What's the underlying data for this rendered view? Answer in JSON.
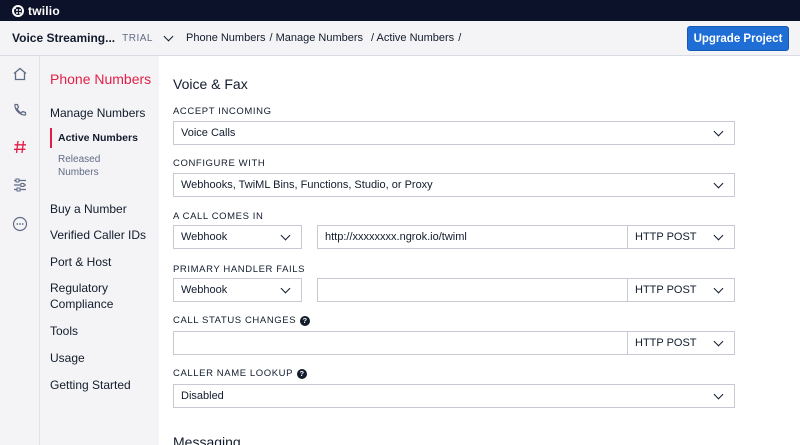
{
  "topbar": {
    "logo_text": "twilio"
  },
  "header": {
    "project_name": "Voice Streaming...",
    "plan_badge": "TRIAL",
    "breadcrumbs": [
      "Phone Numbers",
      "/ Manage Numbers",
      "/ Active Numbers",
      "/"
    ],
    "upgrade_label": "Upgrade Project"
  },
  "rail": {
    "icons": [
      "home-icon",
      "phone-icon",
      "hash-icon",
      "sliders-icon",
      "more-icon"
    ],
    "active": "hash-icon"
  },
  "sidebar": {
    "title": "Phone Numbers",
    "group": "Manage Numbers",
    "sub_items": [
      {
        "label": "Active Numbers"
      },
      {
        "label": "Released Numbers"
      }
    ],
    "items": [
      {
        "label": "Buy a Number"
      },
      {
        "label": "Verified Caller IDs"
      },
      {
        "label": "Port & Host"
      },
      {
        "label": "Regulatory Compliance"
      },
      {
        "label": "Tools"
      },
      {
        "label": "Usage"
      },
      {
        "label": "Getting Started"
      }
    ]
  },
  "main": {
    "section_title": "Voice & Fax",
    "accept_incoming": {
      "label": "ACCEPT INCOMING",
      "value": "Voice Calls"
    },
    "configure_with": {
      "label": "CONFIGURE WITH",
      "value": "Webhooks, TwiML Bins, Functions, Studio, or Proxy"
    },
    "call_comes_in": {
      "label": "A CALL COMES IN",
      "type": "Webhook",
      "url": "http://xxxxxxxx.ngrok.io/twiml",
      "method": "HTTP POST"
    },
    "primary_handler_fails": {
      "label": "PRIMARY HANDLER FAILS",
      "type": "Webhook",
      "url": "",
      "method": "HTTP POST"
    },
    "call_status_changes": {
      "label": "CALL STATUS CHANGES",
      "url": "",
      "method": "HTTP POST"
    },
    "caller_name_lookup": {
      "label": "CALLER NAME LOOKUP",
      "value": "Disabled"
    },
    "next_section_title": "Messaging"
  },
  "colors": {
    "brand_red": "#e31e46",
    "button_blue": "#1f6ed6",
    "topbar_navy": "#0d122b"
  }
}
